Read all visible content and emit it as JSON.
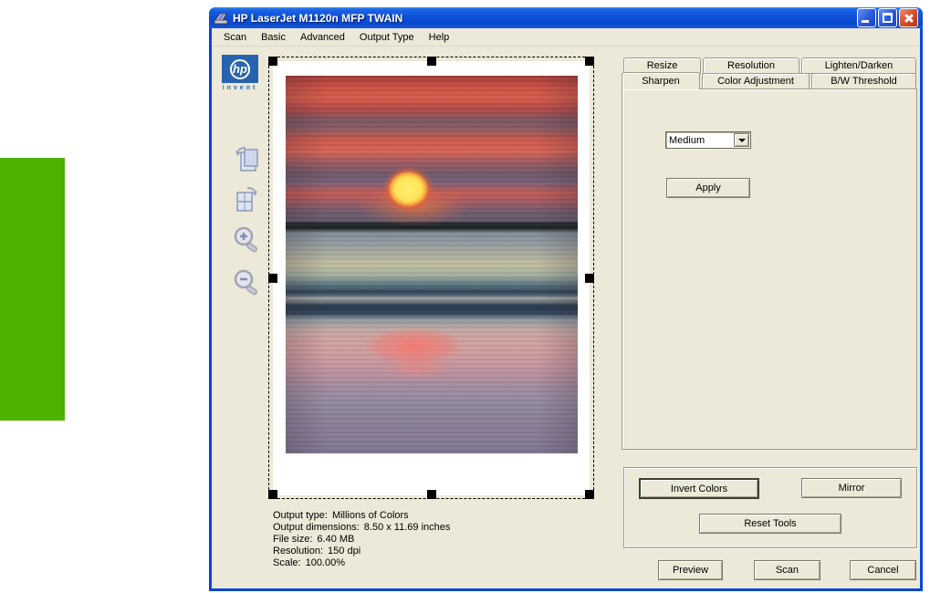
{
  "window": {
    "title": "HP LaserJet M1120n MFP TWAIN"
  },
  "menu": {
    "items": [
      "Scan",
      "Basic",
      "Advanced",
      "Output Type",
      "Help"
    ]
  },
  "branding": {
    "hp": "hp",
    "invent": "invent"
  },
  "tabs": {
    "row1": [
      "Resize",
      "Resolution",
      "Lighten/Darken"
    ],
    "row2": [
      "Sharpen",
      "Color Adjustment",
      "B/W Threshold"
    ],
    "active": "Sharpen"
  },
  "sharpen": {
    "level": "Medium",
    "apply": "Apply"
  },
  "output_info": {
    "rows": [
      {
        "label": "Output type:",
        "value": "Millions of Colors"
      },
      {
        "label": "Output dimensions:",
        "value": "8.50 x 11.69 inches"
      },
      {
        "label": "File size:",
        "value": "6.40 MB"
      },
      {
        "label": "Resolution:",
        "value": "150 dpi"
      },
      {
        "label": "Scale:",
        "value": "100.00%"
      }
    ]
  },
  "tools": {
    "invert_colors": "Invert Colors",
    "mirror": "Mirror",
    "reset_tools": "Reset Tools"
  },
  "actions": {
    "preview": "Preview",
    "scan": "Scan",
    "cancel": "Cancel"
  },
  "colors": {
    "titlebar_blue": "#0c50d8",
    "window_border": "#0a46d4",
    "dialog_bg": "#ece9d8",
    "green_banner": "#4cb400",
    "hp_logo_blue": "#2864ae",
    "close_button_red": "#d9552e"
  }
}
